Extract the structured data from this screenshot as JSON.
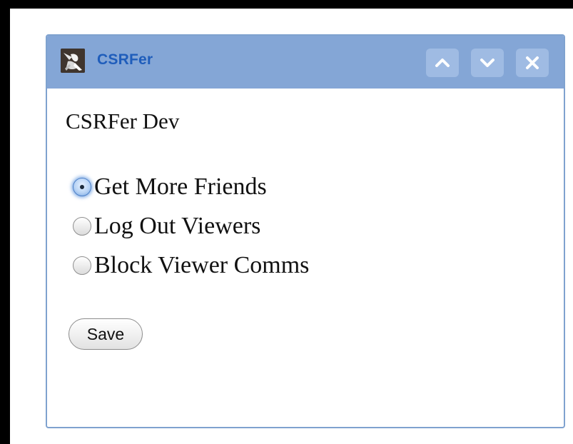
{
  "gadget": {
    "title": "CSRFer",
    "logo_icon": "spy-logo-icon",
    "controls": [
      {
        "name": "minimize",
        "icon": "chevron-up-icon"
      },
      {
        "name": "expand",
        "icon": "chevron-down-icon"
      },
      {
        "name": "close",
        "icon": "close-icon"
      }
    ],
    "title_color": "#1f5dbb",
    "titlebar_color": "#84a6d6"
  },
  "content": {
    "app_name": "CSRFer Dev",
    "options": [
      {
        "label": "Get More Friends",
        "checked": true
      },
      {
        "label": "Log Out Viewers",
        "checked": false
      },
      {
        "label": "Block Viewer Comms",
        "checked": false
      }
    ],
    "save_label": "Save"
  }
}
